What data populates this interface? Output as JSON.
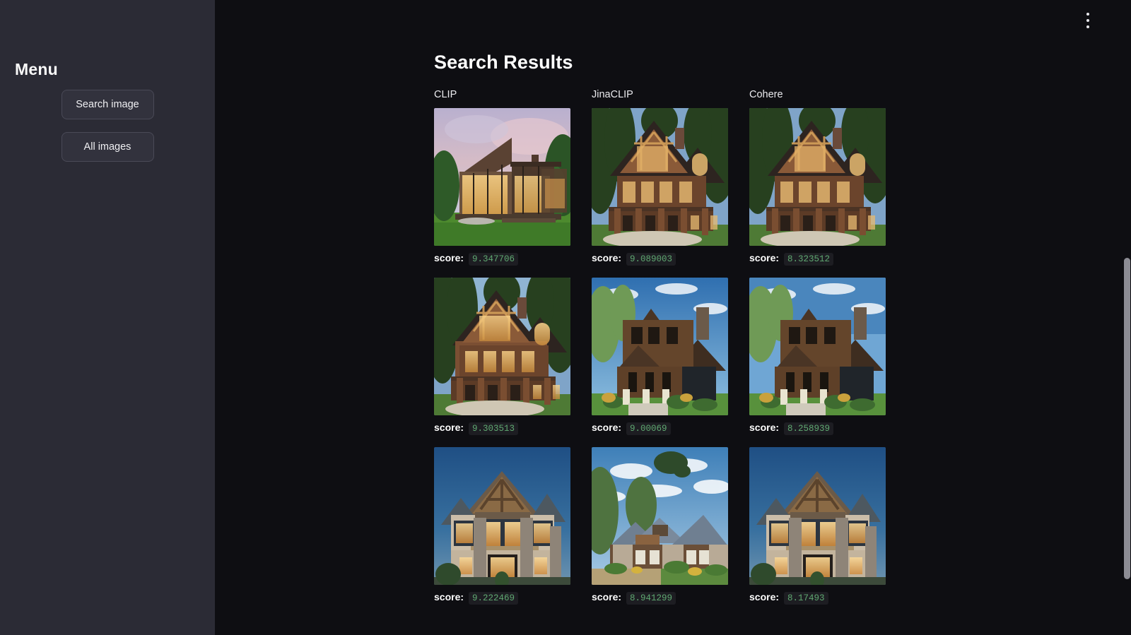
{
  "sidebar": {
    "title": "Menu",
    "buttons": [
      {
        "label": "Search image",
        "name": "search-image-button"
      },
      {
        "label": "All images",
        "name": "all-images-button"
      }
    ]
  },
  "topbar": {
    "menu_icon": "kebab-menu-icon"
  },
  "main": {
    "page_title": "Search Results",
    "score_label": "score:",
    "columns": [
      {
        "header": "CLIP",
        "results": [
          {
            "score": "9.347706",
            "image": "modern-glass-house-dusk"
          },
          {
            "score": "9.303513",
            "image": "timber-frame-log-cabin"
          },
          {
            "score": "9.222469",
            "image": "luxury-home-twilight"
          }
        ]
      },
      {
        "header": "JinaCLIP",
        "results": [
          {
            "score": "9.089003",
            "image": "timber-frame-log-cabin"
          },
          {
            "score": "9.00069",
            "image": "brown-wooden-cottage"
          },
          {
            "score": "8.941299",
            "image": "craftsman-ranch-house"
          }
        ]
      },
      {
        "header": "Cohere",
        "results": [
          {
            "score": "8.323512",
            "image": "timber-frame-log-cabin"
          },
          {
            "score": "8.258939",
            "image": "brown-wooden-cottage"
          },
          {
            "score": "8.17493",
            "image": "luxury-home-twilight"
          }
        ]
      }
    ]
  },
  "colors": {
    "sidebar_bg": "#2b2b35",
    "main_bg": "#0e0e12",
    "score_green": "#5fa871",
    "scrollbar_thumb": "#8c8c94"
  }
}
